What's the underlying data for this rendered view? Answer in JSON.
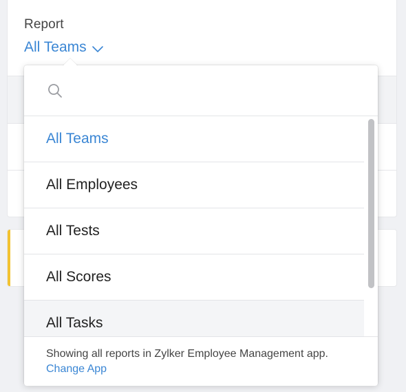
{
  "report": {
    "label": "Report",
    "selected": "All Teams"
  },
  "dropdown": {
    "search_placeholder": "",
    "options": [
      {
        "label": "All Teams",
        "selected": true
      },
      {
        "label": "All Employees",
        "selected": false
      },
      {
        "label": "All Tests",
        "selected": false
      },
      {
        "label": "All Scores",
        "selected": false
      },
      {
        "label": "All Tasks",
        "selected": false
      }
    ],
    "footer": {
      "message": "Showing all reports in Zylker Employee Management app.",
      "link_label": "Change App"
    }
  },
  "colors": {
    "accent": "#3a86d4",
    "warning_bar": "#f2c230"
  },
  "icons": {
    "search": "search-icon",
    "chevron": "chevron-down-icon"
  }
}
